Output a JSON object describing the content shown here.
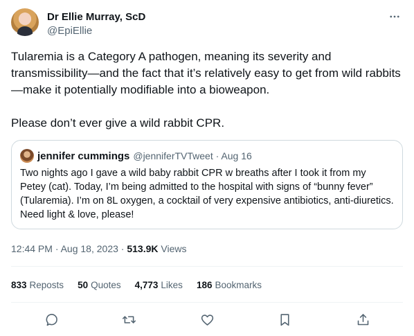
{
  "author": {
    "name": "Dr Ellie Murray, ScD",
    "handle": "@EpiEllie"
  },
  "tweet": {
    "text": "Tularemia is a Category A pathogen, meaning its severity and transmissibility—and the fact that it’s relatively easy to get from wild rabbits—make it potentially modifiable into a bioweapon.\n\nPlease don’t ever give a wild rabbit CPR.",
    "time": "12:44 PM · Aug 18, 2023 · ",
    "views_count": "513.9K",
    "views_label": " Views"
  },
  "quote": {
    "name": "jennifer cummings",
    "meta": "@jenniferTVTweet · Aug 16",
    "text": "Two nights ago I gave a wild baby rabbit CPR w breaths after I took it from my Petey (cat). Today, I’m being admitted to the hospital with signs of “bunny fever” (Tularemia). I’m on 8L oxygen, a cocktail of very expensive antibiotics, anti-diuretics. Need light & love, please!"
  },
  "stats": {
    "reposts_count": "833",
    "reposts_label": "Reposts",
    "quotes_count": "50",
    "quotes_label": "Quotes",
    "likes_count": "4,773",
    "likes_label": "Likes",
    "bookmarks_count": "186",
    "bookmarks_label": "Bookmarks"
  },
  "icons": {
    "more": "more-horizontal-icon",
    "reply": "reply-icon",
    "repost": "repost-icon",
    "like": "heart-icon",
    "bookmark": "bookmark-icon",
    "share": "share-icon"
  },
  "colors": {
    "text": "#0f1419",
    "secondary": "#536471",
    "border": "#cfd9de"
  }
}
